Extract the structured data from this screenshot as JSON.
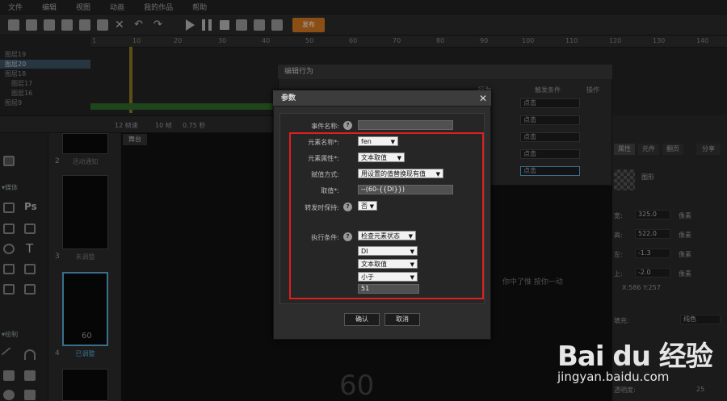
{
  "menu": [
    "文件",
    "编辑",
    "视图",
    "动画",
    "我的作品",
    "帮助"
  ],
  "toolbar": {
    "publish_label": "发布"
  },
  "timeline": {
    "ticks": [
      "1",
      "10",
      "20",
      "30",
      "40",
      "50",
      "60",
      "70",
      "80",
      "90",
      "100",
      "110",
      "120",
      "130",
      "140"
    ],
    "layers": [
      {
        "label": "图层19",
        "selected": false
      },
      {
        "label": "图层20",
        "selected": true
      },
      {
        "label": "图层18",
        "selected": false
      },
      {
        "label": "图层17",
        "selected": false
      },
      {
        "label": "图层16",
        "selected": false
      },
      {
        "label": "图层9",
        "selected": false
      }
    ],
    "status": {
      "frames": "12 帧速",
      "frame": "10 帧",
      "seconds": "0.75 秒"
    }
  },
  "tools": {
    "section_a": "▾媒体",
    "section_b": "▾绘制",
    "ps_label": "Ps",
    "text_label": "T"
  },
  "slides": [
    {
      "number": "2",
      "label": "活动通知"
    },
    {
      "number": "3",
      "label": "未调整"
    },
    {
      "number": "4",
      "label": "已调整"
    }
  ],
  "stage": {
    "tab": "舞台",
    "big_number": "60",
    "overlay_text": "你中了惟 按你一动",
    "slide_time": "60"
  },
  "properties": {
    "tabs": [
      "属性",
      "元件",
      "翻页",
      "分享"
    ],
    "name_label": "图形",
    "fields": [
      {
        "label": "宽:",
        "value": "325.0",
        "unit": "像素"
      },
      {
        "label": "高:",
        "value": "522.0",
        "unit": "像素"
      },
      {
        "label": "左:",
        "value": "-1.3",
        "unit": "像素"
      },
      {
        "label": "上:",
        "value": "-2.0",
        "unit": "像素"
      }
    ],
    "coords": "X:586  Y:257",
    "fill_label": "填充:",
    "fill_value": "纯色",
    "opacity_label": "透明度:",
    "opacity_value": "25"
  },
  "edit_behavior": {
    "title": "编辑行为",
    "headers": [
      "行为",
      "触发条件",
      "操作"
    ],
    "trigger_values": [
      "点击",
      "点击",
      "点击",
      "点击",
      "点击"
    ]
  },
  "params": {
    "title": "参数",
    "event_name_label": "事件名称:",
    "event_name_value": "",
    "element_name_label": "元素名称*:",
    "element_name_value": "fen",
    "element_attr_label": "元素属性*:",
    "element_attr_value": "文本取值",
    "assign_label": "赋值方式:",
    "assign_value": "用设置的值替换现有值",
    "value_label": "取值*:",
    "value_value": "--(60-{{DI}})",
    "trigger_keep_label": "转发时保持:",
    "trigger_keep_value": "否",
    "exec_cond_label": "执行条件:",
    "exec_cond_value": "检查元素状态",
    "cond_element": "DI",
    "cond_attr": "文本取值",
    "cond_op": "小于",
    "cond_value": "51",
    "ok_label": "确认",
    "cancel_label": "取消"
  },
  "watermark": {
    "logo": "Bai du 经验",
    "url": "jingyan.baidu.com"
  }
}
